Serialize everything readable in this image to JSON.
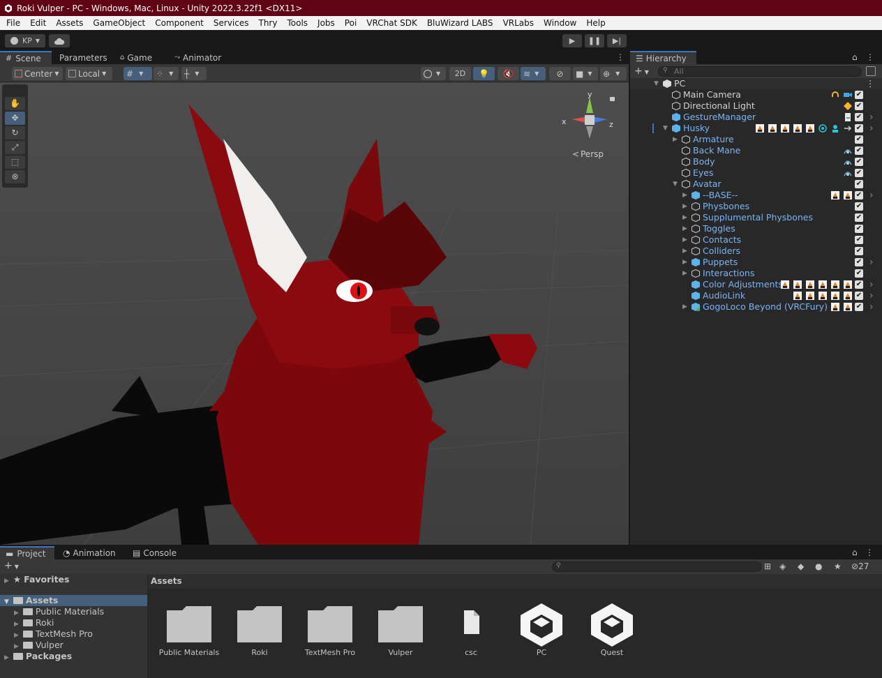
{
  "window": {
    "title": "Roki Vulper - PC - Windows, Mac, Linux - Unity 2022.3.22f1 <DX11>"
  },
  "menu": [
    "File",
    "Edit",
    "Assets",
    "GameObject",
    "Component",
    "Services",
    "Thry",
    "Tools",
    "Jobs",
    "Poi",
    "VRChat SDK",
    "BluWizard LABS",
    "VRLabs",
    "Window",
    "Help"
  ],
  "toolbar": {
    "account": "KP"
  },
  "scene_panel": {
    "tabs": [
      "Scene",
      "Parameters",
      "Game",
      "Animator"
    ],
    "pivot": "Center",
    "space": "Local",
    "mode_2d": "2D",
    "camera_mode": "Persp",
    "gizmo_axes": {
      "x": "x",
      "y": "y",
      "z": "z"
    }
  },
  "hierarchy": {
    "tab": "Hierarchy",
    "search_placeholder": "All",
    "scene_name": "PC",
    "items": [
      {
        "name": "Main Camera",
        "color": "white"
      },
      {
        "name": "Directional Light",
        "color": "white"
      },
      {
        "name": "GestureManager",
        "color": "blue"
      },
      {
        "name": "Husky",
        "color": "blue"
      },
      {
        "name": "Armature",
        "color": "blue"
      },
      {
        "name": "Back Mane",
        "color": "blue"
      },
      {
        "name": "Body",
        "color": "blue"
      },
      {
        "name": "Eyes",
        "color": "blue"
      },
      {
        "name": "Avatar",
        "color": "blue"
      },
      {
        "name": "--BASE--",
        "color": "blue"
      },
      {
        "name": "Physbones",
        "color": "blue"
      },
      {
        "name": "Supplumental Physbones",
        "color": "blue"
      },
      {
        "name": "Toggles",
        "color": "blue"
      },
      {
        "name": "Contacts",
        "color": "blue"
      },
      {
        "name": "Colliders",
        "color": "blue"
      },
      {
        "name": "Puppets",
        "color": "blue"
      },
      {
        "name": "Interactions",
        "color": "blue"
      },
      {
        "name": "Color Adjustments",
        "color": "blue"
      },
      {
        "name": "AudioLink",
        "color": "blue"
      },
      {
        "name": "GogoLoco Beyond (VRCFury)",
        "color": "blue"
      }
    ]
  },
  "project_panel": {
    "tabs": [
      "Project",
      "Animation",
      "Console"
    ],
    "hidden_count": "27",
    "tree": {
      "favorites": "Favorites",
      "assets": "Assets",
      "children": [
        "Public Materials",
        "Roki",
        "TextMesh Pro",
        "Vulper"
      ],
      "packages": "Packages"
    },
    "breadcrumb": "Assets",
    "assets": [
      "Public Materials",
      "Roki",
      "TextMesh Pro",
      "Vulper",
      "csc",
      "PC",
      "Quest"
    ]
  },
  "colors": {
    "title_bar": "#600314",
    "accent": "#3a79bb",
    "blue_text": "#7bb4f5"
  }
}
